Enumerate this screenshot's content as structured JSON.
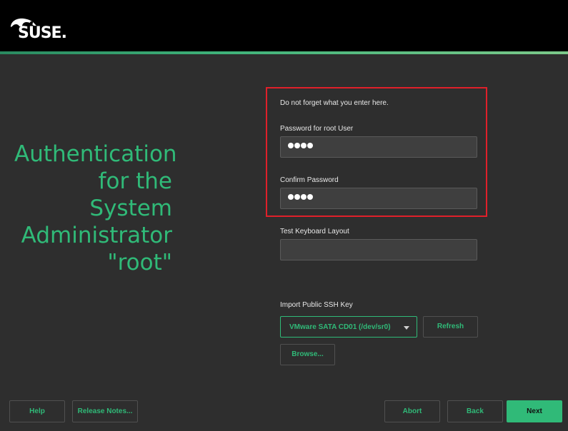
{
  "header": {
    "logo_text": "SUSE."
  },
  "title": {
    "line1": "Authentication",
    "line2": "for the System",
    "line3": "Administrator",
    "line4": "\"root\""
  },
  "form": {
    "hint": "Do not forget what you enter here.",
    "password_label": "Password for root User",
    "confirm_label": "Confirm Password",
    "keyboard_label": "Test Keyboard Layout",
    "ssh_label": "Import Public SSH Key",
    "ssh_source_selected": "VMware SATA CD01 (/dev/sr0)",
    "refresh_label": "Refresh",
    "browse_label": "Browse..."
  },
  "footer": {
    "help_label": "Help",
    "release_notes_label": "Release Notes...",
    "abort_label": "Abort",
    "back_label": "Back",
    "next_label": "Next"
  },
  "colors": {
    "accent": "#30ba78",
    "highlight": "#e0202a",
    "background": "#2e2e2e",
    "topbar": "#000000"
  },
  "icons": [
    "suse-chameleon-logo-icon",
    "dropdown-arrow-icon"
  ]
}
